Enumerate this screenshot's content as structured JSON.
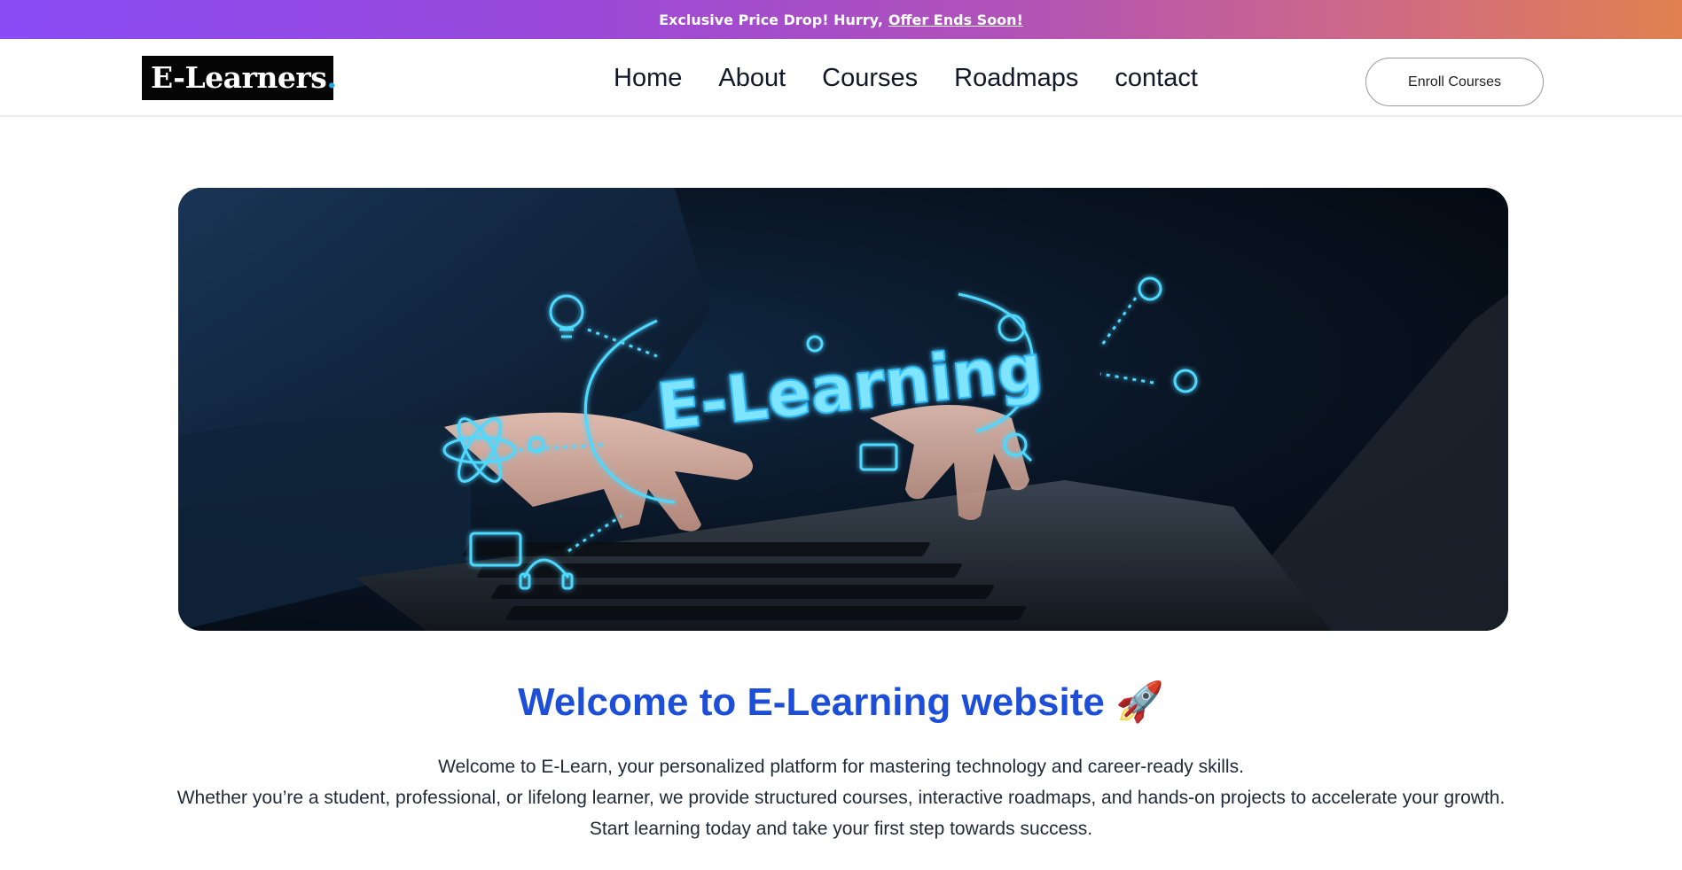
{
  "promo": {
    "text": "Exclusive Price Drop! Hurry,",
    "link": "Offer Ends Soon!"
  },
  "header": {
    "logo_text": "E-Learners",
    "logo_dot": ".",
    "nav": [
      "Home",
      "About",
      "Courses",
      "Roadmaps",
      "contact"
    ],
    "enroll_label": "Enroll Courses"
  },
  "hero": {
    "image_label": "E-Learning"
  },
  "welcome": {
    "title": "Welcome to E-Learning website",
    "title_emoji": "🚀",
    "lines": [
      "Welcome to E-Learn, your personalized platform for mastering technology and career-ready skills.",
      "Whether you’re a student, professional, or lifelong learner, we provide structured courses, interactive roadmaps, and hands-on projects to accelerate your growth.",
      "Start learning today and take your first step towards success."
    ]
  },
  "colors": {
    "accent": "#1d4ed8",
    "glow": "#4fd8ff"
  }
}
